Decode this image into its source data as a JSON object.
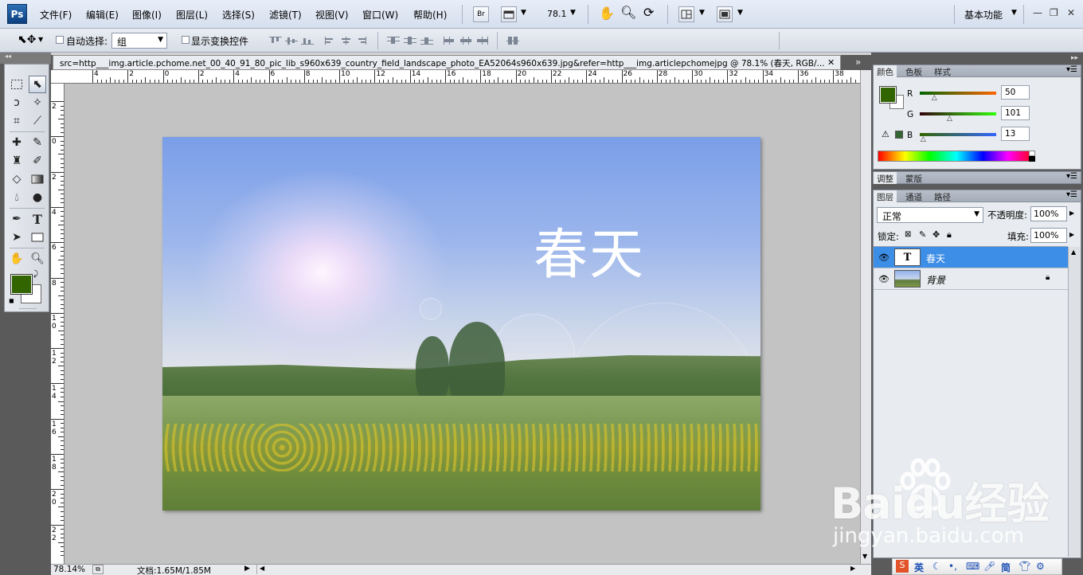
{
  "app": {
    "logo": "Ps"
  },
  "menu": [
    "文件(F)",
    "编辑(E)",
    "图像(I)",
    "图层(L)",
    "选择(S)",
    "滤镜(T)",
    "视图(V)",
    "窗口(W)",
    "帮助(H)"
  ],
  "menubar": {
    "bridge_label": "Br",
    "zoom_value": "78.1",
    "workspace": "基本功能"
  },
  "options": {
    "auto_select_label": "自动选择:",
    "auto_select_value": "组",
    "show_transform_label": "显示变换控件"
  },
  "document": {
    "tab_title": "src=http___img.article.pchome.net_00_40_91_80_pic_lib_s960x639_country_field_landscape_photo_EA52064s960x639.jpg&refer=http___img.articlepchomejpg @ 78.1% (春天, RGB/...",
    "image_text": "春天",
    "ruler_h": [
      "4",
      "2",
      "0",
      "2",
      "4",
      "6",
      "8",
      "10",
      "12",
      "14",
      "16",
      "18",
      "20",
      "22",
      "24",
      "26",
      "28",
      "30",
      "32",
      "34",
      "36",
      "38"
    ],
    "ruler_v": [
      "2",
      "0",
      "2",
      "4",
      "6",
      "8",
      "1 0",
      "1 2",
      "1 4",
      "1 6",
      "1 8",
      "2 0",
      "2 2"
    ]
  },
  "status": {
    "zoom": "78.14%",
    "doc_size": "文档:1.65M/1.85M"
  },
  "color_panel": {
    "tabs": [
      "颜色",
      "色板",
      "样式"
    ],
    "r_label": "R",
    "g_label": "G",
    "b_label": "B",
    "r": "50",
    "g": "101",
    "b": "13",
    "r_pct": 0.196,
    "g_pct": 0.396,
    "b_pct": 0.051,
    "foreground": "#326500",
    "background": "#ffffff"
  },
  "adjust_panel": {
    "tabs": [
      "调整",
      "蒙版"
    ]
  },
  "layers_panel": {
    "tabs": [
      "图层",
      "通道",
      "路径"
    ],
    "blend_mode": "正常",
    "opacity_label": "不透明度:",
    "opacity": "100%",
    "lock_label": "锁定:",
    "fill_label": "填充:",
    "fill": "100%",
    "layers": [
      {
        "name": "春天",
        "thumb": "T",
        "selected": true
      },
      {
        "name": "背景",
        "thumb": "",
        "selected": false
      }
    ]
  },
  "watermark": {
    "logo": "Baidu经验",
    "url": "jingyan.baidu.com"
  },
  "ime": {
    "lang": "英",
    "mode": "简"
  }
}
